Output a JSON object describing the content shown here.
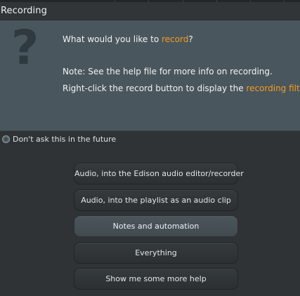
{
  "window": {
    "title": "Recording"
  },
  "message": {
    "line1_prefix": "What would you like to ",
    "line1_highlight": "record",
    "line1_suffix": "?",
    "line2": "Note: See the help file for more info on recording.",
    "line3_prefix": "Right-click the record button to display the ",
    "line3_highlight": "recording filter",
    "line3_suffix": ".",
    "icon": "question-mark-icon",
    "icon_glyph": "?"
  },
  "option": {
    "dont_ask_label": "Don't ask this in the future",
    "dont_ask_checked": false
  },
  "buttons": [
    {
      "label": "Audio, into the Edison audio editor/recorder",
      "active": false
    },
    {
      "label": "Audio, into the playlist as an audio clip",
      "active": false
    },
    {
      "label": "Notes and automation",
      "active": true
    },
    {
      "label": "Everything",
      "active": false
    },
    {
      "label": "Show me some more help",
      "active": false
    }
  ],
  "colors": {
    "accent": "#f39c1f",
    "panel": "#4a565d",
    "background": "#2f3335"
  }
}
